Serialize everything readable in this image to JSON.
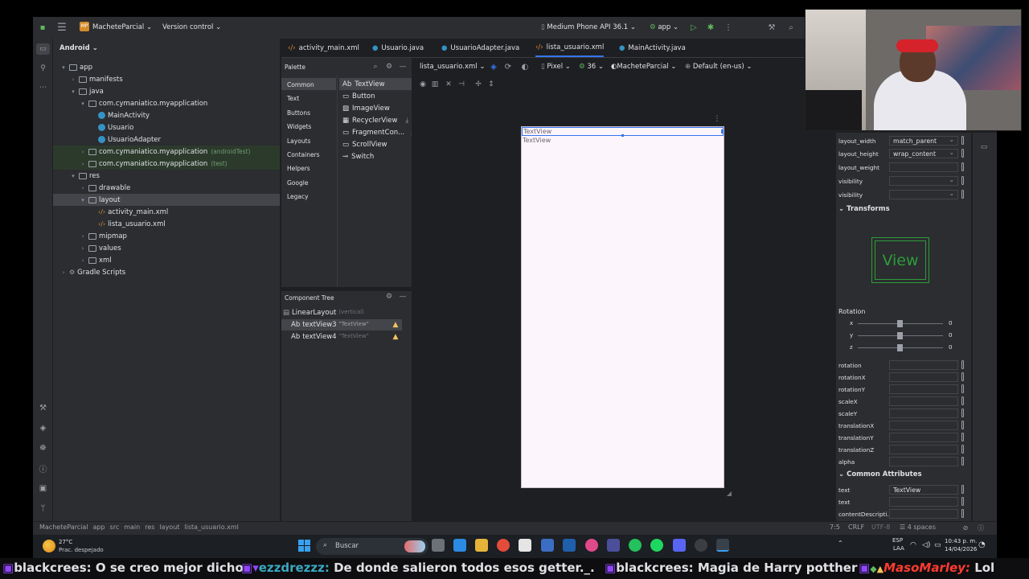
{
  "titlebar": {
    "project_badge": "MP",
    "project_name": "MacheteParcial",
    "vcs": "Version control",
    "device": "Medium Phone API 36.1",
    "run_config": "app"
  },
  "project_panel": {
    "view_selector": "Android",
    "tree": [
      {
        "label": "app",
        "hint": ""
      },
      {
        "label": "manifests",
        "hint": ""
      },
      {
        "label": "java",
        "hint": ""
      },
      {
        "label": "com.cymaniatico.myapplication",
        "hint": ""
      },
      {
        "label": "MainActivity",
        "hint": ""
      },
      {
        "label": "Usuario",
        "hint": ""
      },
      {
        "label": "UsuarioAdapter",
        "hint": ""
      },
      {
        "label": "com.cymaniatico.myapplication",
        "hint": "(androidTest)"
      },
      {
        "label": "com.cymaniatico.myapplication",
        "hint": "(test)"
      },
      {
        "label": "res",
        "hint": ""
      },
      {
        "label": "drawable",
        "hint": ""
      },
      {
        "label": "layout",
        "hint": ""
      },
      {
        "label": "activity_main.xml",
        "hint": ""
      },
      {
        "label": "lista_usuario.xml",
        "hint": ""
      },
      {
        "label": "mipmap",
        "hint": ""
      },
      {
        "label": "values",
        "hint": ""
      },
      {
        "label": "xml",
        "hint": ""
      },
      {
        "label": "Gradle Scripts",
        "hint": ""
      }
    ]
  },
  "tabs": [
    "activity_main.xml",
    "Usuario.java",
    "UsuarioAdapter.java",
    "lista_usuario.xml",
    "MainActivity.java"
  ],
  "palette": {
    "title": "Palette",
    "categories": [
      "Common",
      "Text",
      "Buttons",
      "Widgets",
      "Layouts",
      "Containers",
      "Helpers",
      "Google",
      "Legacy"
    ],
    "items": [
      {
        "prefix": "Ab",
        "label": "TextView"
      },
      {
        "prefix": "",
        "label": "Button"
      },
      {
        "prefix": "",
        "label": "ImageView"
      },
      {
        "prefix": "",
        "label": "RecyclerView"
      },
      {
        "prefix": "",
        "label": "FragmentCon..."
      },
      {
        "prefix": "",
        "label": "ScrollView"
      },
      {
        "prefix": "",
        "label": "Switch"
      }
    ]
  },
  "component_tree": {
    "title": "Component Tree",
    "root": {
      "label": "LinearLayout",
      "hint": "(vertical)"
    },
    "children": [
      {
        "prefix": "Ab",
        "label": "textView3",
        "hint": "\"TextView\""
      },
      {
        "prefix": "Ab",
        "label": "textView4",
        "hint": "\"TextView\""
      }
    ]
  },
  "design_toolbar": {
    "file": "lista_usuario.xml",
    "device": "Pixel",
    "api": "36",
    "theme": "MacheteParcial",
    "locale": "Default (en-us)"
  },
  "canvas": {
    "text1": "TextView",
    "text2": "TextView"
  },
  "attributes": {
    "rows": [
      {
        "label": "layout_width",
        "value": "match_parent"
      },
      {
        "label": "layout_height",
        "value": "wrap_content"
      },
      {
        "label": "layout_weight",
        "value": ""
      },
      {
        "label": "visibility",
        "value": ""
      },
      {
        "label": "visibility",
        "value": ""
      }
    ],
    "transforms_title": "Transforms",
    "preview_label": "View",
    "rotation_title": "Rotation",
    "rotation_axes": [
      {
        "axis": "x",
        "value": "0"
      },
      {
        "axis": "y",
        "value": "0"
      },
      {
        "axis": "z",
        "value": "0"
      }
    ],
    "transform_rows": [
      "rotation",
      "rotationX",
      "rotationY",
      "scaleX",
      "scaleY",
      "translationX",
      "translationY",
      "translationZ",
      "alpha"
    ],
    "common_title": "Common Attributes",
    "common_rows": [
      {
        "label": "text",
        "value": "TextView"
      },
      {
        "label": "text",
        "value": ""
      },
      {
        "label": "contentDescripti...",
        "value": ""
      }
    ]
  },
  "statusbar": {
    "breadcrumb": [
      "MacheteParcial",
      "app",
      "src",
      "main",
      "res",
      "layout",
      "lista_usuario.xml"
    ],
    "position": "7:5",
    "line_sep": "CRLF",
    "encoding": "UTF-8",
    "indent": "4 spaces"
  },
  "taskbar": {
    "temp": "27°C",
    "weather": "Prac. despejado",
    "search": "Buscar",
    "lang1": "ESP",
    "lang2": "LAA",
    "time": "10:43 p. m.",
    "date": "14/04/2026"
  },
  "chat": [
    {
      "user": "blackcrees:",
      "msg": "O se creo mejor dicho",
      "color": "#ffffff"
    },
    {
      "user": "ezzdrezzz:",
      "msg": "De donde salieron todos esos getter._.",
      "color": "#3aa8c1"
    },
    {
      "user": "blackcrees:",
      "msg": "Magia de Harry potther",
      "color": "#ffffff"
    },
    {
      "user": "MasoMarley:",
      "msg": "Lol",
      "color": "#ff3b30"
    }
  ],
  "colors": {
    "accent": "#3574f0",
    "warning": "#f2c55c",
    "green_border": "#2e9c3a"
  }
}
